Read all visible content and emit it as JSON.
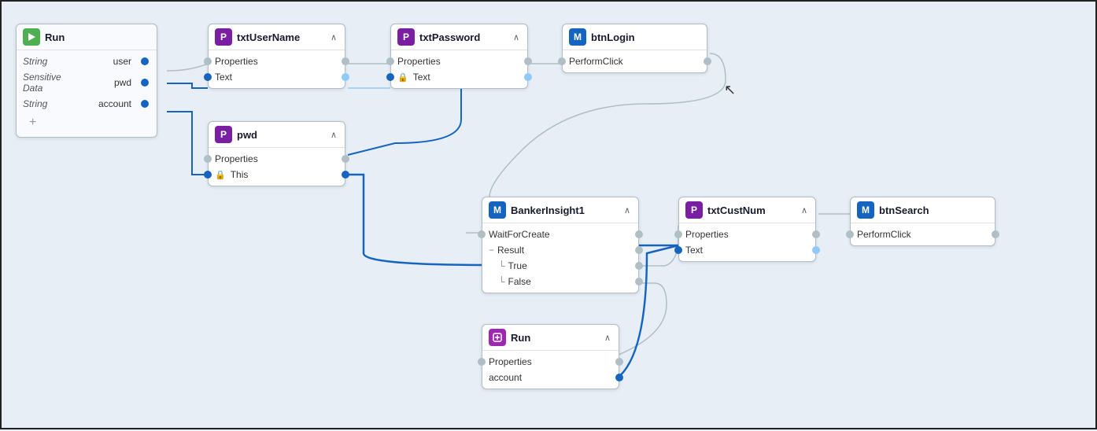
{
  "nodes": {
    "run_left": {
      "title": "Run",
      "icon": "R",
      "icon_class": "icon-green",
      "rows": [
        {
          "label": "user",
          "label_style": "",
          "type_label": "String",
          "port_left": false,
          "port_right": true,
          "port_right_color": "port-blue"
        },
        {
          "label": "pwd",
          "label_style": "",
          "type_label": "Sensitive Data",
          "port_left": false,
          "port_right": true,
          "port_right_color": "port-blue"
        },
        {
          "label": "account",
          "label_style": "",
          "type_label": "String",
          "port_left": false,
          "port_right": true,
          "port_right_color": "port-blue"
        }
      ],
      "has_add": true
    },
    "txt_username": {
      "title": "txtUserName",
      "icon": "P",
      "icon_class": "icon-purple",
      "rows": [
        {
          "label": "Properties",
          "port_left": true,
          "port_right": true,
          "port_right_color": "port-gray"
        },
        {
          "label": "Text",
          "port_left": true,
          "port_right": true,
          "port_right_color": "port-light-blue"
        }
      ]
    },
    "txt_password": {
      "title": "txtPassword",
      "icon": "P",
      "icon_class": "icon-purple",
      "rows": [
        {
          "label": "Properties",
          "port_left": true,
          "port_right": true,
          "port_right_color": "port-gray"
        },
        {
          "label": "Text",
          "lock": true,
          "port_left": true,
          "port_right": true,
          "port_right_color": "port-light-blue"
        }
      ]
    },
    "btn_login": {
      "title": "btnLogin",
      "icon": "M",
      "icon_class": "icon-blue",
      "rows": [
        {
          "label": "PerformClick",
          "port_left": true,
          "port_right": true,
          "port_right_color": "port-gray"
        }
      ]
    },
    "pwd": {
      "title": "pwd",
      "icon": "P",
      "icon_class": "icon-purple",
      "rows": [
        {
          "label": "Properties",
          "port_left": true,
          "port_right": true,
          "port_right_color": "port-gray"
        },
        {
          "label": "This",
          "lock": true,
          "port_left": true,
          "port_right": true,
          "port_right_color": "port-blue"
        }
      ]
    },
    "banker_insight": {
      "title": "BankerInsight1",
      "icon": "M",
      "icon_class": "icon-blue",
      "rows": [
        {
          "label": "WaitForCreate",
          "port_left": true,
          "port_right": true,
          "port_right_color": "port-gray"
        },
        {
          "label": "Result",
          "tree_prefix": "−",
          "port_left": false,
          "port_right": true,
          "port_right_color": "port-gray"
        },
        {
          "label": "True",
          "tree_prefix": "└",
          "port_left": false,
          "port_right": true,
          "port_right_color": "port-gray"
        },
        {
          "label": "False",
          "tree_prefix": "└",
          "port_left": false,
          "port_right": true,
          "port_right_color": "port-gray"
        }
      ]
    },
    "txt_custnum": {
      "title": "txtCustNum",
      "icon": "P",
      "icon_class": "icon-purple",
      "rows": [
        {
          "label": "Properties",
          "port_left": true,
          "port_right": true,
          "port_right_color": "port-gray"
        },
        {
          "label": "Text",
          "port_left": true,
          "port_right": true,
          "port_right_color": "port-light-blue"
        }
      ]
    },
    "btn_search": {
      "title": "btnSearch",
      "icon": "M",
      "icon_class": "icon-blue",
      "rows": [
        {
          "label": "PerformClick",
          "port_left": true,
          "port_right": true,
          "port_right_color": "port-gray"
        }
      ]
    },
    "run_bottom": {
      "title": "Run",
      "icon": "R",
      "icon_class": "icon-purple-light",
      "rows": [
        {
          "label": "Properties",
          "port_left": true,
          "port_right": true,
          "port_right_color": "port-gray"
        },
        {
          "label": "account",
          "port_left": false,
          "port_right": true,
          "port_right_color": "port-blue"
        }
      ]
    }
  }
}
